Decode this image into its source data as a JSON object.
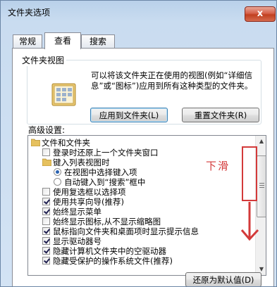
{
  "window": {
    "title": "文件夹选项",
    "close_label": "x"
  },
  "tabs": [
    {
      "label": "常规"
    },
    {
      "label": "查看"
    },
    {
      "label": "搜索"
    }
  ],
  "folder_views": {
    "title": "文件夹视图",
    "description": "可以将该文件夹正在使用的视图(例如“详细信息”或“图标”)应用到所有这种类型的文件夹。",
    "apply_button": "应用到文件夹(L)",
    "reset_button": "重置文件夹(R)"
  },
  "advanced": {
    "label": "高级设置:",
    "items": [
      {
        "type": "folder",
        "label": "文件和文件夹"
      },
      {
        "type": "checkbox",
        "checked": false,
        "label": "登录时还原上一个文件夹窗口"
      },
      {
        "type": "folder",
        "label": "键入列表视图时"
      },
      {
        "type": "radio",
        "checked": true,
        "label": "在视图中选择键入项"
      },
      {
        "type": "radio",
        "checked": false,
        "label": "自动键入到“搜索”框中"
      },
      {
        "type": "checkbox",
        "checked": false,
        "label": "使用复选框以选择项"
      },
      {
        "type": "checkbox",
        "checked": true,
        "label": "使用共享向导(推荐)"
      },
      {
        "type": "checkbox",
        "checked": true,
        "label": "始终显示菜单"
      },
      {
        "type": "checkbox",
        "checked": false,
        "label": "始终显示图标,从不显示缩略图"
      },
      {
        "type": "checkbox",
        "checked": true,
        "label": "鼠标指向文件夹和桌面项时显示提示信息"
      },
      {
        "type": "checkbox",
        "checked": true,
        "label": "显示驱动器号"
      },
      {
        "type": "checkbox",
        "checked": true,
        "label": "隐藏计算机文件夹中的空驱动器"
      },
      {
        "type": "checkbox",
        "checked": true,
        "label": "隐藏受保护的操作系统文件(推荐)"
      }
    ],
    "restore_button": "还原为默认值(D)"
  },
  "annotation": {
    "text": "下滑",
    "color": "#d33a3a"
  }
}
